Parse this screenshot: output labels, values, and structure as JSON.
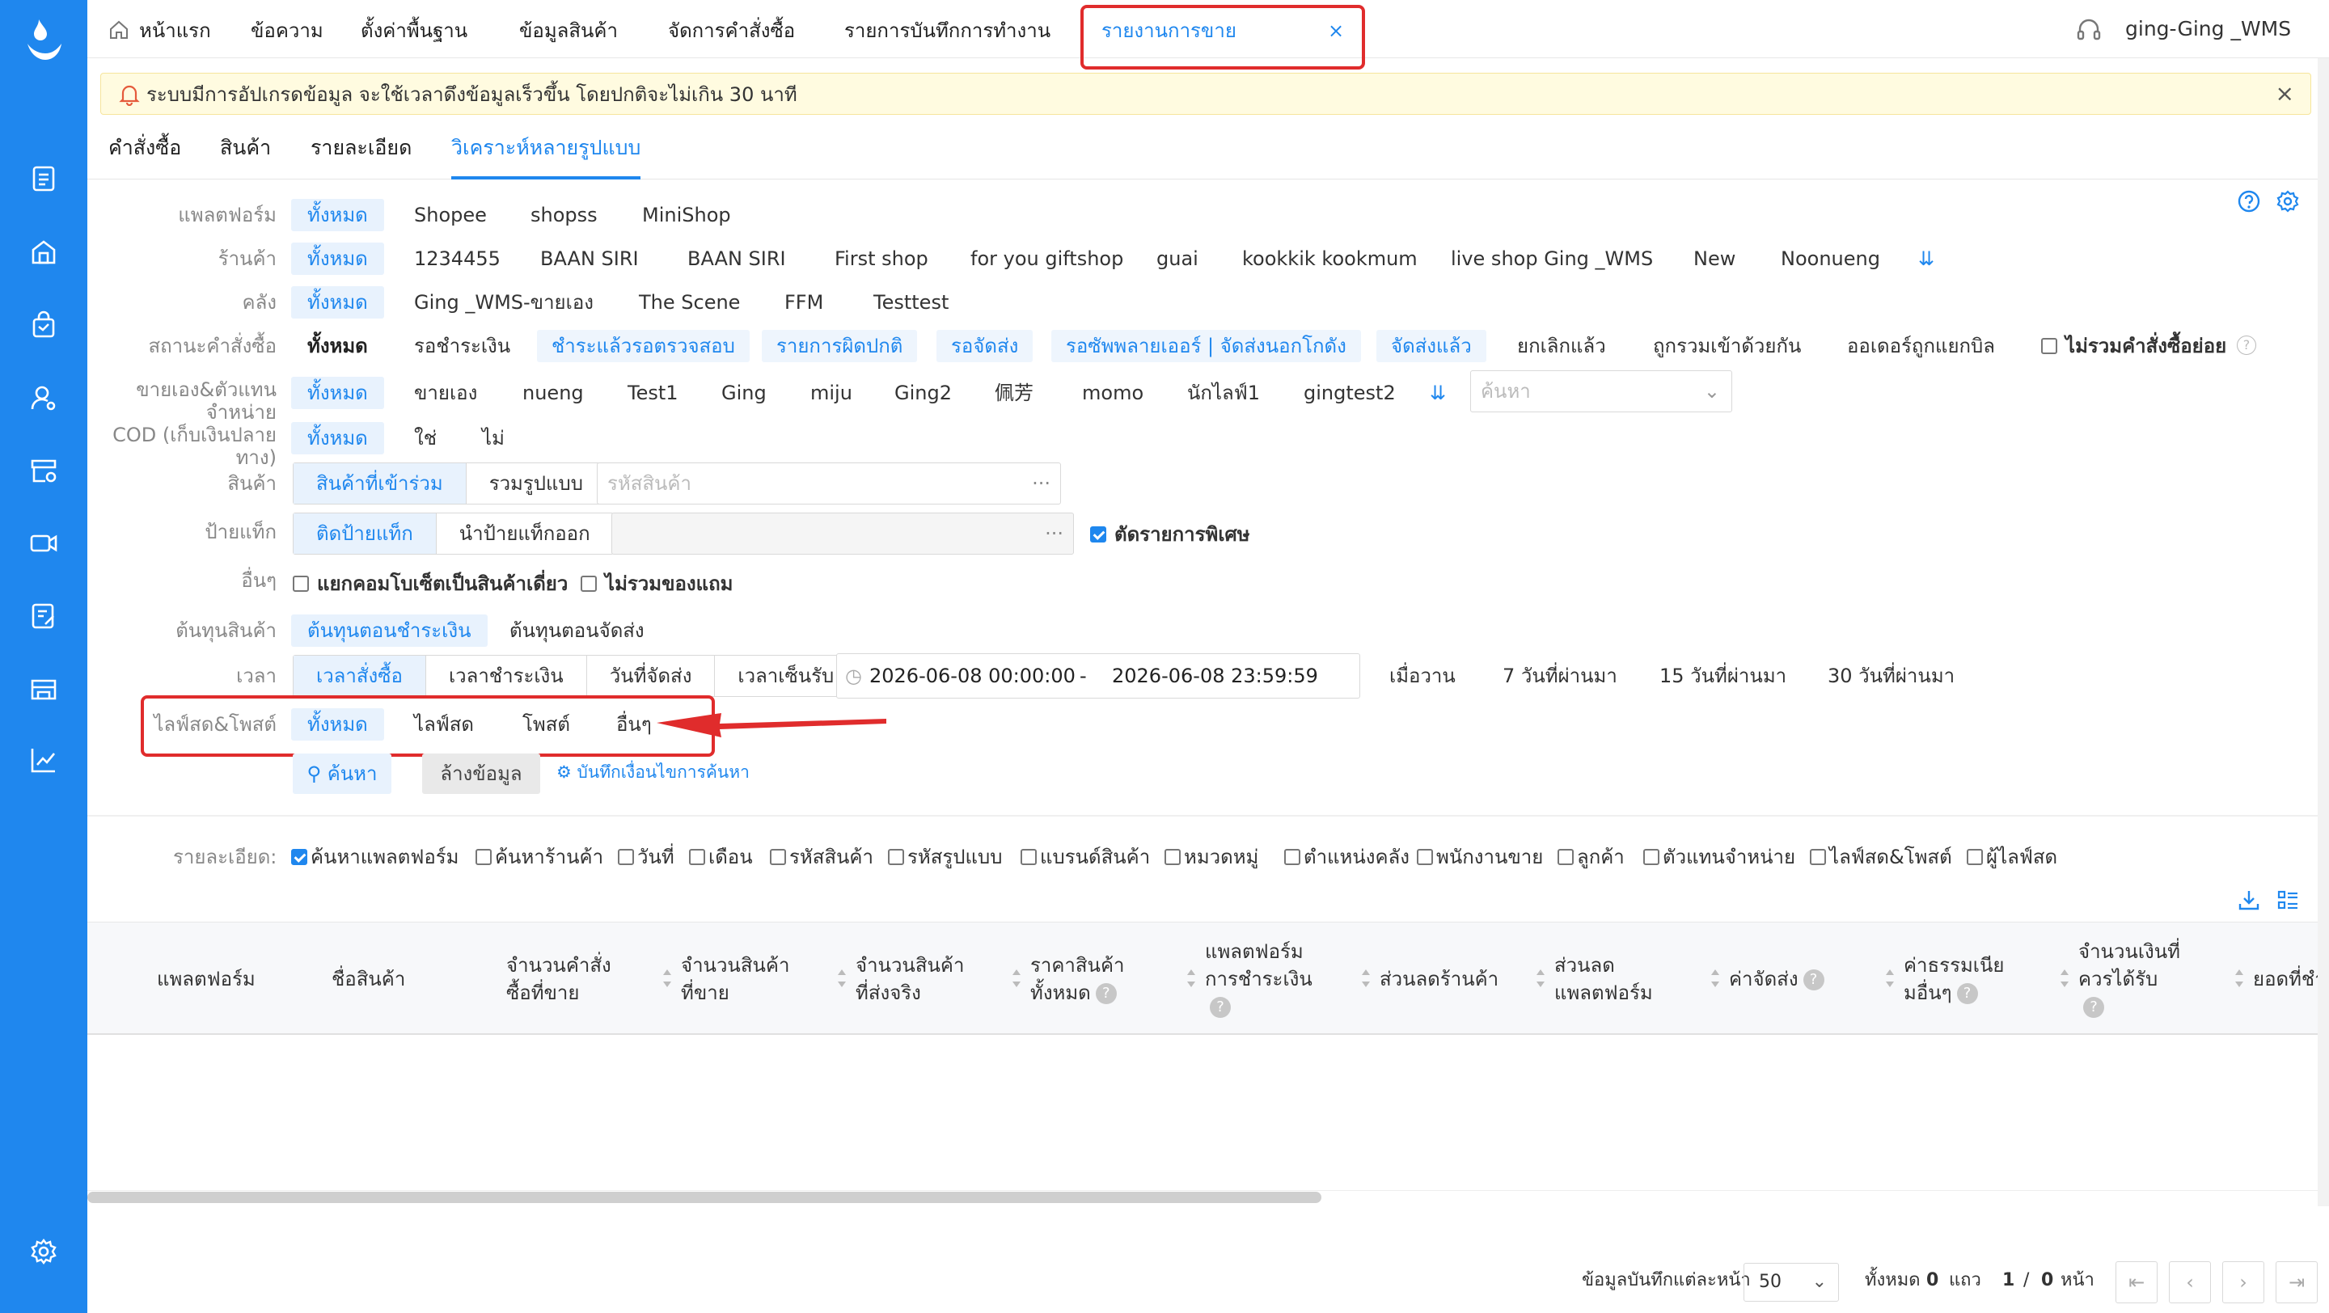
{
  "topnav": {
    "items": [
      "หน้าแรก",
      "ข้อความ",
      "ตั้งค่าพื้นฐาน",
      "ข้อมูลสินค้า",
      "จัดการคำสั่งซื้อ",
      "รายการบันทึกการทำงาน"
    ],
    "active_tab": "รายงานการขาย",
    "active_close": "×",
    "user": "ging-Ging _WMS"
  },
  "notice": {
    "text": "ระบบมีการอัปเกรดข้อมูล จะใช้เวลาดึงข้อมูลเร็วขึ้น โดยปกติจะไม่เกิน 30 นาที",
    "close": "×"
  },
  "subtabs": [
    "คำสั่งซื้อ",
    "สินค้า",
    "รายละเอียด",
    "วิเคราะห์หลายรูปแบบ"
  ],
  "filters": {
    "platform": {
      "label": "แพลตฟอร์ม",
      "options": [
        "ทั้งหมด",
        "Shopee",
        "shopss",
        "MiniShop"
      ]
    },
    "store": {
      "label": "ร้านค้า",
      "options": [
        "ทั้งหมด",
        "1234455",
        "BAAN SIRI",
        "BAAN SIRI",
        "First shop",
        "for you giftshop",
        "guai",
        "kookkik kookmum",
        "live shop Ging _WMS",
        "New",
        "Noonueng"
      ]
    },
    "warehouse": {
      "label": "คลัง",
      "options": [
        "ทั้งหมด",
        "Ging _WMS-ขายเอง",
        "The Scene",
        "FFM",
        "Testtest"
      ]
    },
    "order_status": {
      "label": "สถานะคำสั่งซื้อ",
      "options": [
        "ทั้งหมด",
        "รอชำระเงิน",
        "ชำระแล้วรอตรวจสอบ",
        "รายการผิดปกติ",
        "รอจัดส่ง",
        "รอซัพพลายเออร์ | จัดส่งนอกโกดัง",
        "จัดส่งแล้ว",
        "ยกเลิกแล้ว",
        "ถูกรวมเข้าด้วยกัน",
        "ออเดอร์ถูกแยกบิล"
      ],
      "exclude_sub": "ไม่รวมคำสั่งซื้อย่อย"
    },
    "seller": {
      "label": "ขายเอง&ตัวแทนจำหน่าย",
      "options": [
        "ทั้งหมด",
        "ขายเอง",
        "nueng",
        "Test1",
        "Ging",
        "miju",
        "Ging2",
        "佩芳",
        "momo",
        "นักไลฟ์1",
        "gingtest2"
      ],
      "search_placeholder": "ค้นหา"
    },
    "cod": {
      "label": "COD (เก็บเงินปลายทาง)",
      "options": [
        "ทั้งหมด",
        "ใช่",
        "ไม่"
      ]
    },
    "product": {
      "label": "สินค้า",
      "seg": [
        "สินค้าที่เข้าร่วม",
        "รวมรูปแบบ"
      ],
      "placeholder": "รหัสสินค้า",
      "dots": "···"
    },
    "tag": {
      "label": "ป้ายแท็ก",
      "seg": [
        "ติดป้ายแท็ก",
        "นำป้ายแท็กออก"
      ],
      "dots": "···",
      "special": "ตัดรายการพิเศษ"
    },
    "other": {
      "label": "อื่นๆ",
      "combo": "แยกคอมโบเซ็ตเป็นสินค้าเดี่ยว",
      "no_gift": "ไม่รวมของแถม"
    },
    "cost": {
      "label": "ต้นทุนสินค้า",
      "options": [
        "ต้นทุนตอนชำระเงิน",
        "ต้นทุนตอนจัดส่ง"
      ]
    },
    "time": {
      "label": "เวลา",
      "seg": [
        "เวลาสั่งซื้อ",
        "เวลาชำระเงิน",
        "วันที่จัดส่ง",
        "เวลาเซ็นรับ"
      ],
      "start": "2026-06-08 00:00:00",
      "sep": "-",
      "end": "2026-06-08 23:59:59",
      "quick": [
        "เมื่อวาน",
        "7 วันที่ผ่านมา",
        "15 วันที่ผ่านมา",
        "30 วันที่ผ่านมา"
      ]
    },
    "live": {
      "label": "ไลฟ์สด&โพสต์",
      "options": [
        "ทั้งหมด",
        "ไลฟ์สด",
        "โพสต์",
        "อื่นๆ"
      ]
    }
  },
  "actions": {
    "search": "ค้นหา",
    "clear": "ล้างข้อมูล",
    "save": "บันทึกเงื่อนไขการค้นหา"
  },
  "details": {
    "label": "รายละเอียด:",
    "items": [
      {
        "t": "ค้นหาแพลตฟอร์ม",
        "on": true
      },
      {
        "t": "ค้นหาร้านค้า",
        "on": false
      },
      {
        "t": "วันที่",
        "on": false
      },
      {
        "t": "เดือน",
        "on": false
      },
      {
        "t": "รหัสสินค้า",
        "on": false
      },
      {
        "t": "รหัสรูปแบบ",
        "on": false
      },
      {
        "t": "แบรนด์สินค้า",
        "on": false
      },
      {
        "t": "หมวดหมู่",
        "on": false
      },
      {
        "t": "ตำแหน่งคลัง",
        "on": false
      },
      {
        "t": "พนักงานขาย",
        "on": false
      },
      {
        "t": "ลูกค้า",
        "on": false
      },
      {
        "t": "ตัวแทนจำหน่าย",
        "on": false
      },
      {
        "t": "ไลฟ์สด&โพสต์",
        "on": false
      },
      {
        "t": "ผู้ไลฟ์สด",
        "on": false
      }
    ]
  },
  "table": {
    "columns": [
      "แพลตฟอร์ม",
      "ชื่อสินค้า",
      "จำนวนคำสั่งซื้อที่ขาย",
      "จำนวนสินค้าที่ขาย",
      "จำนวนสินค้าที่ส่งจริง",
      "ราคาสินค้าทั้งหมด",
      "แพลตฟอร์มการชำระเงิน",
      "ส่วนลดร้านค้า",
      "ส่วนลดแพลตฟอร์ม",
      "ค่าจัดส่ง",
      "ค่าธรรมเนียมอื่นๆ",
      "จำนวนเงินที่ควรได้รับ",
      "ยอดที่ชำ"
    ],
    "q": "?"
  },
  "pagination": {
    "per_page_label": "ข้อมูลบันทึกแต่ละหน้า",
    "per_page": "50",
    "total_label": "ทั้งหมด",
    "total": "0",
    "unit": "แถว",
    "page": "1",
    "slash": "/",
    "pages": "0",
    "page_unit": "หน้า"
  },
  "colors": {
    "primary": "#1f87ee",
    "sidebar": "#1f87ee",
    "highlight": "#e02c2c",
    "notice_bg": "#fffbe0"
  }
}
